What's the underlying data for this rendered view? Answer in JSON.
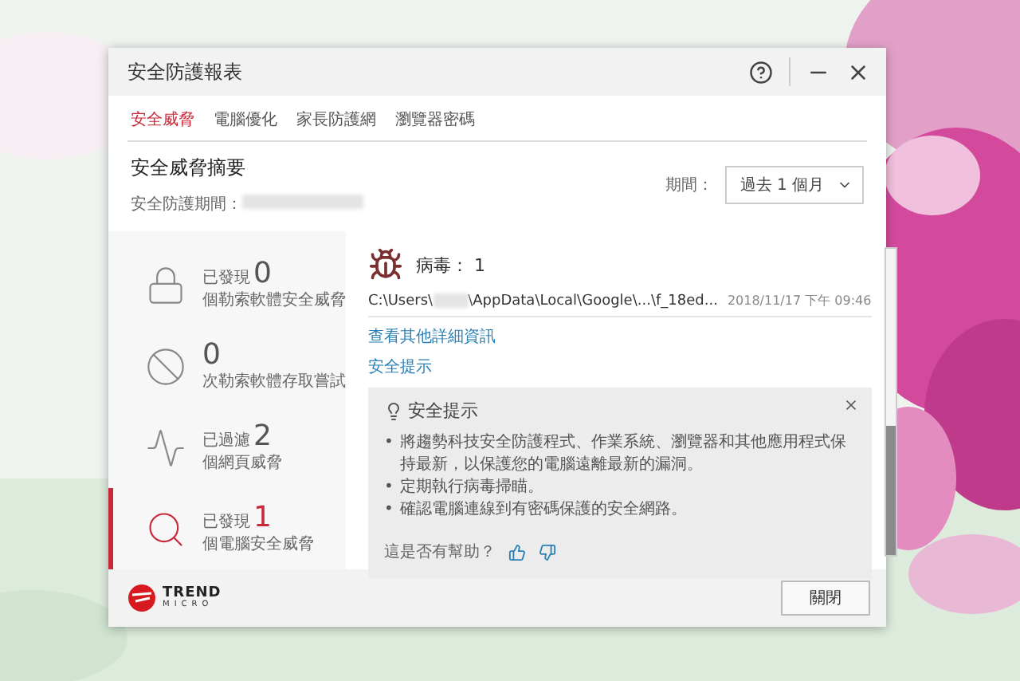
{
  "window": {
    "title": "安全防護報表"
  },
  "tabs": [
    {
      "label": "安全威脅",
      "selected": true
    },
    {
      "label": "電腦優化",
      "selected": false
    },
    {
      "label": "家長防護網",
      "selected": false
    },
    {
      "label": "瀏覽器密碼",
      "selected": false
    }
  ],
  "summary": {
    "title": "安全威脅摘要",
    "period_label": "安全防護期間：",
    "filter_label": "期間：",
    "filter_value": "過去 1 個月"
  },
  "sidebar": {
    "items": [
      {
        "kind": "lock",
        "prefix": "已發現",
        "count": "0",
        "description": "個勒索軟體安全威脅",
        "selected": false
      },
      {
        "kind": "blocked",
        "count": "0",
        "description": "次勒索軟體存取嘗試",
        "selected": false
      },
      {
        "kind": "wave",
        "prefix": "已過濾",
        "count": "2",
        "description": "個網頁威脅",
        "selected": false
      },
      {
        "kind": "search",
        "prefix": "已發現",
        "count": "1",
        "description": "個電腦安全威脅",
        "selected": true
      }
    ]
  },
  "detail": {
    "heading": "病毒： 1",
    "path_start": "C:\\Users\\",
    "path_end": "\\AppData\\Local\\Google\\...\\f_18ed...",
    "date": "2018/11/17 下午 09:46",
    "details_link": "查看其他詳細資訊",
    "tips_link": "安全提示",
    "tips": {
      "title": "安全提示",
      "marker": "•",
      "bullets": [
        "將趨勢科技安全防護程式、作業系統、瀏覽器和其他應用程式保持最新，以保護您的電腦遠離最新的漏洞。",
        "定期執行病毒掃瞄。",
        "確認電腦連線到有密碼保護的安全網路。"
      ],
      "feedback": "這是否有幫助？"
    }
  },
  "footer": {
    "logo_top": "TREND",
    "logo_bottom": "MICRO",
    "close_button": "關閉"
  }
}
